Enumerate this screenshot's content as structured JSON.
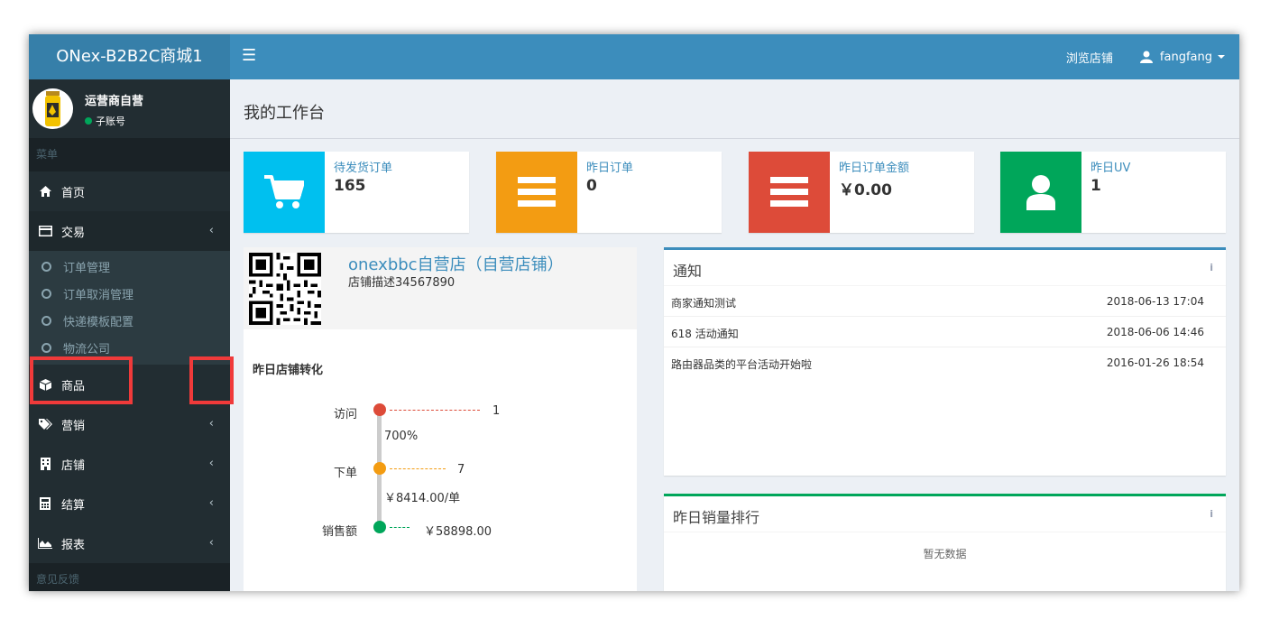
{
  "app": {
    "title": "ONex-B2B2C商城1"
  },
  "topnav": {
    "browse_store": "浏览店铺",
    "username": "fangfang"
  },
  "sidebar": {
    "user_name": "运营商自营",
    "user_status": "子账号",
    "menu_header": "菜单",
    "footer_header": "意见反馈",
    "items": [
      {
        "label": "首页",
        "icon": "home-icon"
      },
      {
        "label": "交易",
        "icon": "credit-card-icon"
      },
      {
        "label": "商品",
        "icon": "cube-icon"
      },
      {
        "label": "营销",
        "icon": "tags-icon"
      },
      {
        "label": "店铺",
        "icon": "building-icon"
      },
      {
        "label": "结算",
        "icon": "calculator-icon"
      },
      {
        "label": "报表",
        "icon": "area-chart-icon"
      }
    ],
    "sub_items": [
      "订单管理",
      "订单取消管理",
      "快递模板配置",
      "物流公司"
    ]
  },
  "page": {
    "title": "我的工作台"
  },
  "stats": [
    {
      "label": "待发货订单",
      "value": "165",
      "color": "#00c0ef",
      "icon": "shopping-cart-icon"
    },
    {
      "label": "昨日订单",
      "value": "0",
      "color": "#f39c12",
      "icon": "list-icon"
    },
    {
      "label": "昨日订单金额",
      "value": "￥0.00",
      "color": "#dd4b39",
      "icon": "list-icon"
    },
    {
      "label": "昨日UV",
      "value": "1",
      "color": "#00a65a",
      "icon": "user-icon"
    }
  ],
  "store": {
    "name": "onexbbc自营店（自营店铺）",
    "desc": "店铺描述34567890",
    "conversion_title": "昨日店铺转化",
    "funnel": {
      "visit_label": "访问",
      "visit_value": "1",
      "rate": "700%",
      "order_label": "下单",
      "order_value": "7",
      "per_order": "￥8414.00/单",
      "sales_label": "销售额",
      "sales_value": "￥58898.00"
    }
  },
  "notice": {
    "title": "通知",
    "tool": "i",
    "rows": [
      {
        "title": "商家通知测试",
        "date": "2018-06-13 17:04"
      },
      {
        "title": "618 活动通知",
        "date": "2018-06-06 14:46"
      },
      {
        "title": "路由器品类的平台活动开始啦",
        "date": "2016-01-26 18:54"
      }
    ]
  },
  "ranking": {
    "title": "昨日销量排行",
    "tool": "i",
    "empty": "暂无数据"
  },
  "colors": {
    "topbar": "#3c8dbc",
    "logo": "#367fa9",
    "sidebar": "#222d32",
    "highlight": "#f03a3a"
  }
}
